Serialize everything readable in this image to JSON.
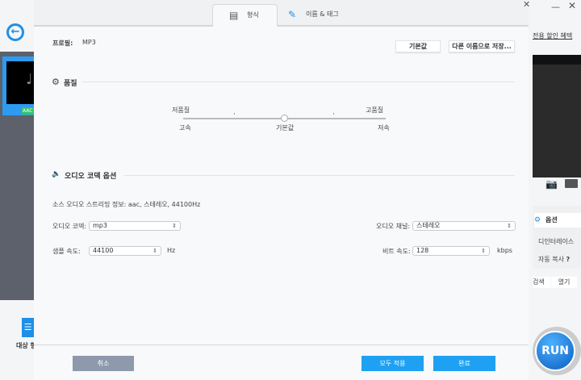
{
  "background": {
    "promo_link": "전용 할인 혜택",
    "badge": "AAC",
    "options_label": "옵션",
    "deinterlace": "디인터레이스",
    "auto_copy": "자동 복사",
    "help": "?",
    "search": "검색",
    "open": "열기",
    "run": "RUN",
    "target_label": "대상 형"
  },
  "tabs": [
    {
      "label": "형식",
      "icon": "format-settings-icon"
    },
    {
      "label": "이름 & 태그",
      "icon": "tag-edit-icon"
    }
  ],
  "profile": {
    "label": "프로필:",
    "value": "MP3",
    "default_button": "기본값",
    "save_as_button": "다른 이름으로 저장..."
  },
  "quality": {
    "title": "품질",
    "low_label": "저품질",
    "high_label": "고품질",
    "fast_label": "고속",
    "default_label": "기본값",
    "slow_label": "저속",
    "value": 0.5
  },
  "codec": {
    "title": "오디오 코덱 옵션",
    "source_info": "소스 오디오 스트리밍 정보: aac, 스테레오, 44100Hz",
    "audio_codec_label": "오디오 코덱:",
    "audio_codec_value": "mp3",
    "channel_label": "오디오 채널:",
    "channel_value": "스테레오",
    "sample_rate_label": "샘플 속도:",
    "sample_rate_value": "44100",
    "sample_rate_unit": "Hz",
    "bitrate_label": "비트 속도:",
    "bitrate_value": "128",
    "bitrate_unit": "kbps"
  },
  "footer": {
    "cancel": "취소",
    "apply_all": "모두 적용",
    "done": "완료"
  },
  "colors": {
    "accent": "#1ea1f2",
    "cancel": "#8e9aab"
  }
}
